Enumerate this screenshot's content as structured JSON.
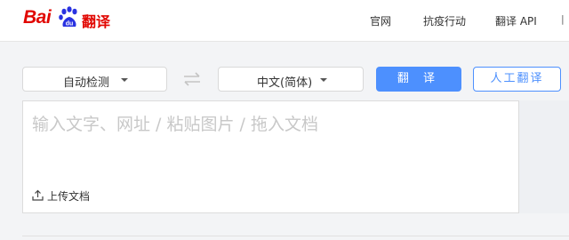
{
  "brand": {
    "logo_text": "Bai",
    "logo_paw_text": "du",
    "product": "翻译",
    "color": "#e10601"
  },
  "nav": {
    "items": [
      "官网",
      "抗疫行动",
      "翻译 API",
      "|"
    ]
  },
  "toolbar": {
    "source_language": "自动检测",
    "target_language": "中文(简体)",
    "translate_button": "翻 译",
    "human_translate_button": "人工翻译",
    "accent_color": "#4d90fe"
  },
  "input": {
    "placeholder": "输入文字、网址 / 粘贴图片 / 拖入文档",
    "upload_label": "上传文档"
  },
  "icons": {
    "swap": "swap-arrows-icon",
    "caret": "chevron-down-icon",
    "upload": "upload-icon"
  }
}
